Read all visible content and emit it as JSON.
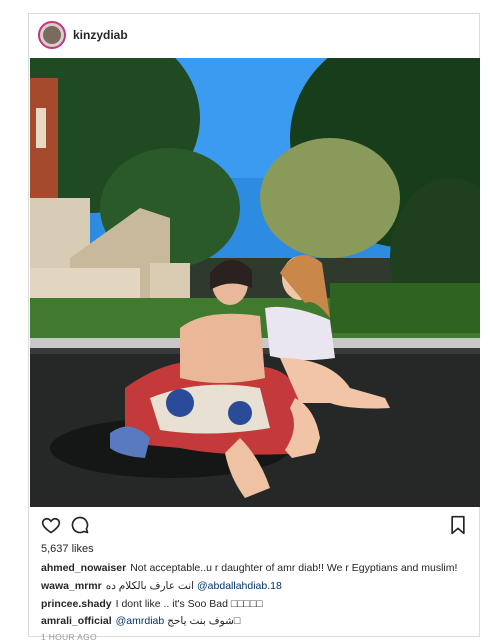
{
  "post": {
    "username": "kinzydiab",
    "likes": "5,637 likes",
    "time": "1 HOUR AGO"
  },
  "icons": {
    "like": "heart-icon",
    "comment": "comment-bubble-icon",
    "save": "bookmark-icon"
  },
  "comments": [
    {
      "user": "ahmed_nowaiser",
      "text": "Not acceptable..u r daughter of amr diab!! We r Egyptians and muslim!"
    },
    {
      "user": "wawa_mrmr",
      "text": "انت عارف بالكلام ده ",
      "mention": "@abdallahdiab.18"
    },
    {
      "user": "princee.shady",
      "text": "I dont like .. it's Soo Bad □□□□□"
    },
    {
      "user": "amrali_official",
      "mention": "@amrdiab",
      "text": " شوف بنت ياحج□"
    }
  ],
  "colors": {
    "text": "#262626",
    "mention": "#003569",
    "border": "#dbdbdb",
    "avatar_ring": "#c13584"
  }
}
